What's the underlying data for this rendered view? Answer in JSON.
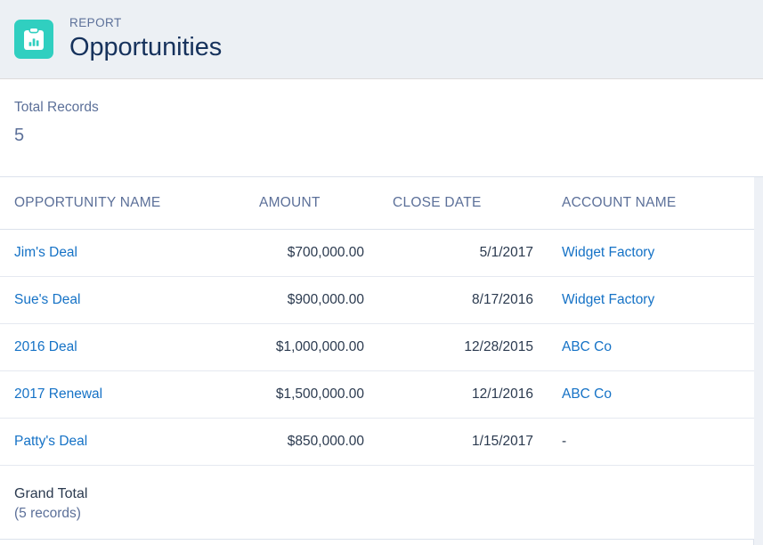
{
  "header": {
    "eyebrow": "REPORT",
    "title": "Opportunities",
    "icon_name": "report-clipboard-chart-icon",
    "icon_color": "#30cfc0",
    "background": "#ecf0f4",
    "title_color": "#16325c",
    "eyebrow_color": "#5c7099"
  },
  "summary": {
    "label": "Total Records",
    "value": "5"
  },
  "table": {
    "columns": [
      {
        "label": "OPPORTUNITY NAME",
        "align": "left"
      },
      {
        "label": "AMOUNT",
        "align": "right"
      },
      {
        "label": "CLOSE DATE",
        "align": "right"
      },
      {
        "label": "ACCOUNT NAME",
        "align": "left"
      }
    ],
    "rows": [
      {
        "opportunity_name": "Jim's Deal",
        "amount": "$700,000.00",
        "close_date": "5/1/2017",
        "account_name": "Widget Factory",
        "account_is_link": true
      },
      {
        "opportunity_name": "Sue's Deal",
        "amount": "$900,000.00",
        "close_date": "8/17/2016",
        "account_name": "Widget Factory",
        "account_is_link": true
      },
      {
        "opportunity_name": "2016 Deal",
        "amount": "$1,000,000.00",
        "close_date": "12/28/2015",
        "account_name": "ABC Co",
        "account_is_link": true
      },
      {
        "opportunity_name": "2017 Renewal",
        "amount": "$1,500,000.00",
        "close_date": "12/1/2016",
        "account_name": "ABC Co",
        "account_is_link": true
      },
      {
        "opportunity_name": "Patty's Deal",
        "amount": "$850,000.00",
        "close_date": "1/15/2017",
        "account_name": "-",
        "account_is_link": false
      }
    ],
    "grand_total": {
      "label": "Grand Total",
      "sublabel": "(5 records)"
    },
    "link_color": "#1572c6"
  }
}
